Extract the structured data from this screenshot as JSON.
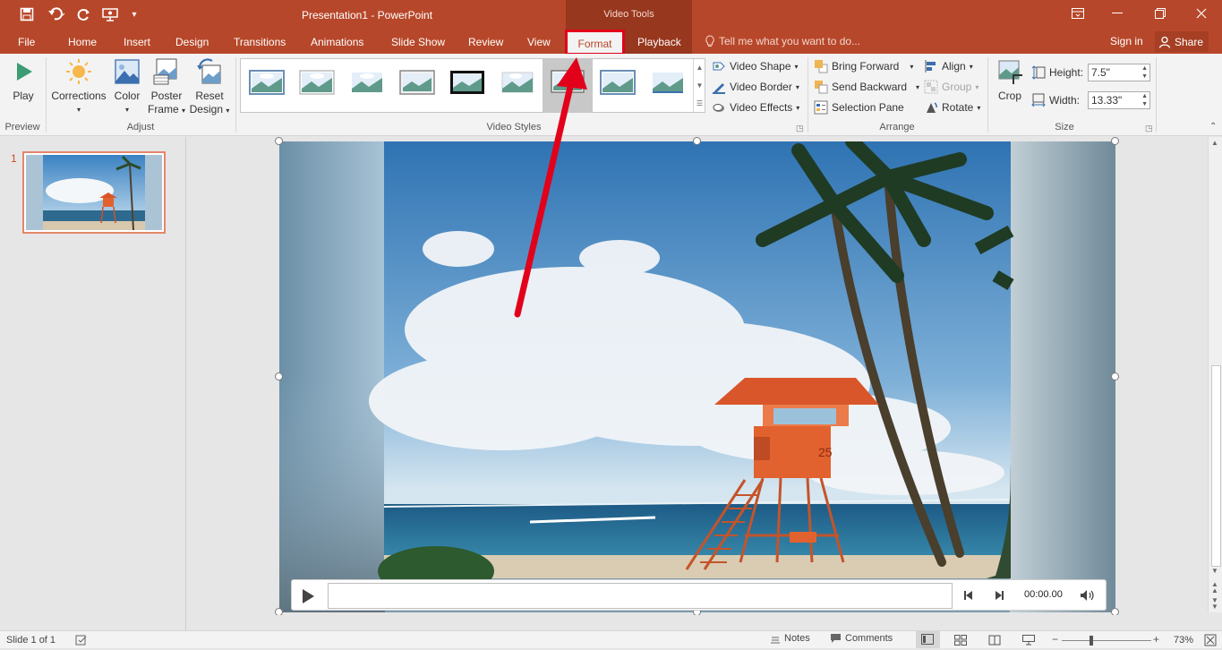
{
  "window": {
    "title": "Presentation1 - PowerPoint",
    "contextual_group": "Video Tools"
  },
  "tabs": [
    {
      "label": "File"
    },
    {
      "label": "Home"
    },
    {
      "label": "Insert"
    },
    {
      "label": "Design"
    },
    {
      "label": "Transitions"
    },
    {
      "label": "Animations"
    },
    {
      "label": "Slide Show"
    },
    {
      "label": "Review"
    },
    {
      "label": "View"
    },
    {
      "label": "Format",
      "active": true
    },
    {
      "label": "Playback"
    }
  ],
  "tell_me": "Tell me what you want to do...",
  "account": {
    "sign_in": "Sign in",
    "share": "Share"
  },
  "ribbon": {
    "preview": {
      "label": "Preview",
      "play": "Play"
    },
    "adjust": {
      "label": "Adjust",
      "corrections": "Corrections",
      "color": "Color",
      "poster_frame_1": "Poster",
      "poster_frame_2": "Frame",
      "reset_1": "Reset",
      "reset_2": "Design"
    },
    "video_styles": {
      "label": "Video Styles",
      "video_shape": "Video Shape",
      "video_border": "Video Border",
      "video_effects": "Video Effects"
    },
    "arrange": {
      "label": "Arrange",
      "bring_forward": "Bring Forward",
      "send_backward": "Send Backward",
      "selection_pane": "Selection Pane",
      "align": "Align",
      "group": "Group",
      "rotate": "Rotate"
    },
    "size": {
      "label": "Size",
      "crop": "Crop",
      "height_label": "Height:",
      "height_value": "7.5\"",
      "width_label": "Width:",
      "width_value": "13.33\""
    }
  },
  "slides": {
    "current": "1"
  },
  "video_controls": {
    "time": "00:00.00",
    "progress": 0
  },
  "status": {
    "slide_info": "Slide 1 of 1",
    "notes": "Notes",
    "comments": "Comments",
    "zoom": "73%"
  },
  "colors": {
    "accent": "#b7472a",
    "highlight": "#e2001a"
  }
}
